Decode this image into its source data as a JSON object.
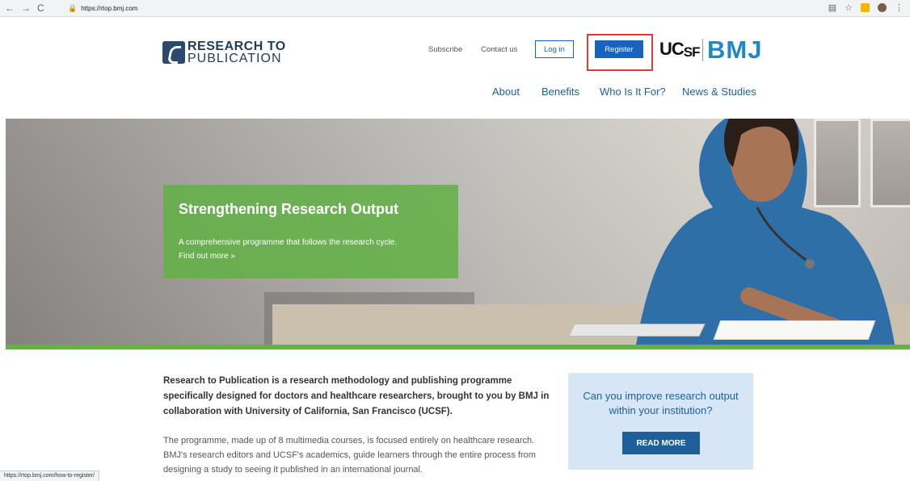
{
  "browser": {
    "back_icon": "←",
    "forward_icon": "→",
    "reload_icon": "C",
    "url": "https://rtop.bmj.com",
    "status_url": "https://rtop.bmj.com/how-to-register/"
  },
  "logo": {
    "line1": "RESEARCH TO",
    "line2": "PUBLICATION"
  },
  "toplinks": {
    "subscribe": "Subscribe",
    "contact": "Contact us",
    "login": "Log in",
    "register": "Register"
  },
  "partners": {
    "ucsf": "UC",
    "ucsf_sub": "SF",
    "bmj": "BMJ"
  },
  "mainnav": [
    "About",
    "Benefits",
    "Who Is It For?",
    "News & Studies"
  ],
  "hero": {
    "title": "Strengthening Research Output",
    "subtitle": "A comprehensive programme that follows the research cycle.",
    "link": "Find out more »"
  },
  "intro": "Research to Publication is a research methodology and publishing programme specifically designed for doctors and healthcare researchers, brought to you by BMJ in collaboration with University of California, San Francisco (UCSF).",
  "body": "The programme, made up of 8 multimedia courses, is focused entirely on healthcare research. BMJ's research editors and UCSF's academics, guide learners through the entire process from designing a study to seeing it published in an international journal.",
  "cta": {
    "question": "Can you improve research output within your institution?",
    "button": "READ MORE"
  },
  "colors": {
    "brand_blue": "#1565c0",
    "green": "#65b048",
    "highlight_red": "#e53935",
    "bmj_blue": "#1e88c8"
  }
}
